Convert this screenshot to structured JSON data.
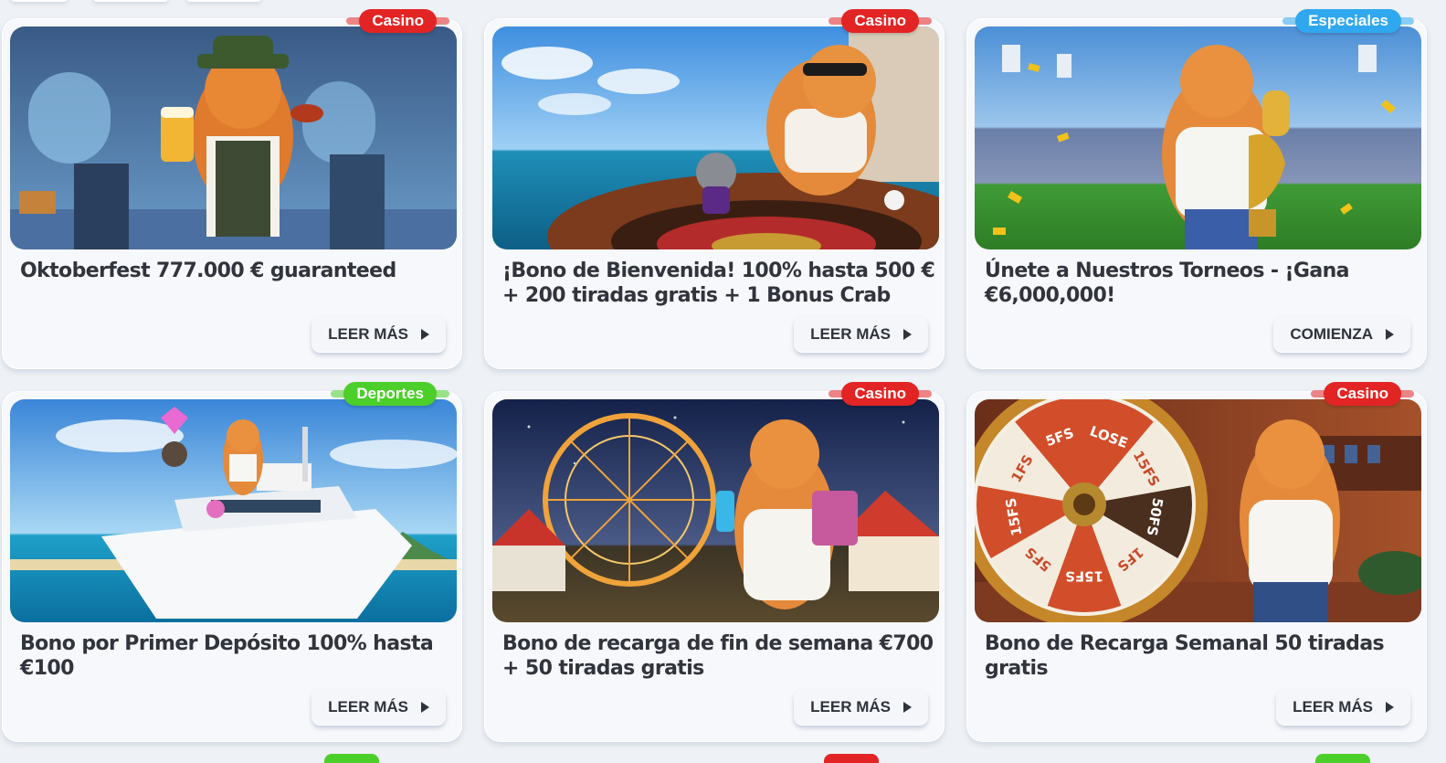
{
  "promotions": [
    {
      "badge": "Casino",
      "badge_color": "#e32424",
      "title": "Oktoberfest 777.000 € guaranteed",
      "button": "LEER MÁS",
      "image_icon": "oktoberfest-cat-image"
    },
    {
      "badge": "Casino",
      "badge_color": "#e32424",
      "title": "¡Bono de Bienvenida! 100% hasta 500 € + 200 tiradas gratis + 1 Bonus Crab",
      "button": "LEER MÁS",
      "image_icon": "roulette-cat-image"
    },
    {
      "badge": "Especiales",
      "badge_color": "#2fa8ef",
      "title": "Únete a Nuestros Torneos - ¡Gana €6,000,000!",
      "button": "COMIENZA",
      "image_icon": "stadium-trophy-cat-image"
    },
    {
      "badge": "Deportes",
      "badge_color": "#4ccf2a",
      "title": "Bono por Primer Depósito 100% hasta €100",
      "button": "LEER MÁS",
      "image_icon": "yacht-cat-image"
    },
    {
      "badge": "Casino",
      "badge_color": "#e32424",
      "title": "Bono de recarga de fin de semana €700 + 50 tiradas gratis",
      "button": "LEER MÁS",
      "image_icon": "ferris-wheel-cat-image"
    },
    {
      "badge": "Casino",
      "badge_color": "#e32424",
      "title": "Bono de Recarga Semanal 50 tiradas gratis",
      "button": "LEER MÁS",
      "image_icon": "prize-wheel-cat-image"
    }
  ],
  "wheel_labels": [
    "LOSE",
    "15FS",
    "50FS",
    "1FS",
    "15FS",
    "5FS",
    "15FS",
    "1FS",
    "5FS"
  ]
}
